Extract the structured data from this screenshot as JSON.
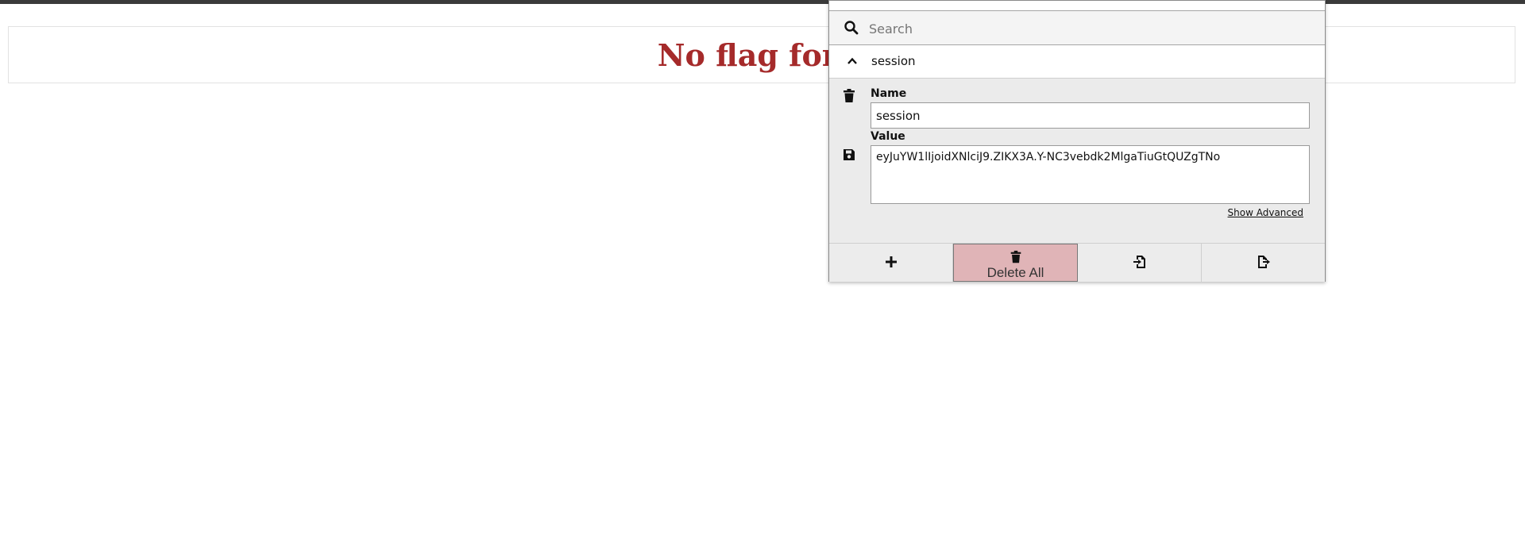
{
  "page": {
    "heading": "No flag for y"
  },
  "popup": {
    "search": {
      "placeholder": "Search",
      "value": ""
    },
    "cookie": {
      "header_label": "session",
      "name_label": "Name",
      "name_value": "session",
      "value_label": "Value",
      "value_value": "eyJuYW1lIjoidXNlciJ9.ZIKX3A.Y-NC3vebdk2MlgaTiuGtQUZgTNo",
      "show_advanced": "Show Advanced"
    },
    "actions": {
      "delete_all_label": "Delete All"
    },
    "icons": {
      "search": "search-icon",
      "collapse": "chevron-up-icon",
      "delete": "trash-icon",
      "save": "save-icon",
      "add": "plus-icon",
      "import": "import-icon",
      "export": "export-icon"
    },
    "colors": {
      "heading": "#a52a2a",
      "delete_all_bg": "#e0b4b7"
    }
  }
}
